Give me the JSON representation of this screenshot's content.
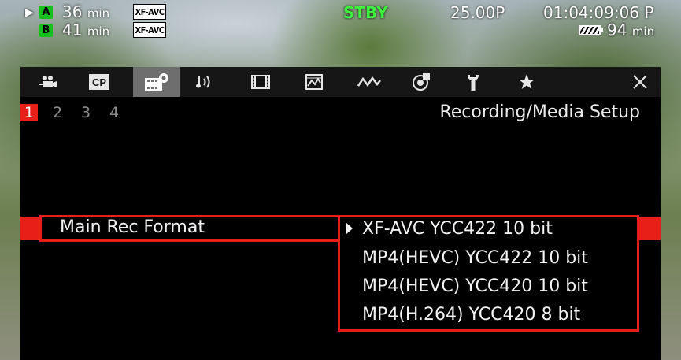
{
  "status": {
    "slot_a": {
      "tag": "A",
      "time": "36",
      "unit": "min",
      "codec": "XF-AVC"
    },
    "slot_b": {
      "tag": "B",
      "time": "41",
      "unit": "min",
      "codec": "XF-AVC"
    },
    "mode": "STBY",
    "frame_rate": "25.00P",
    "timecode": "01:04:09:06 P",
    "battery": {
      "value": "94",
      "unit": "min"
    }
  },
  "tabs": [
    {
      "icon": "camera-icon"
    },
    {
      "icon": "cp-icon",
      "label": "CP"
    },
    {
      "icon": "recording-setup-icon"
    },
    {
      "icon": "audio-icon"
    },
    {
      "icon": "film-icon"
    },
    {
      "icon": "display-assist-icon"
    },
    {
      "icon": "waveform-icon"
    },
    {
      "icon": "custom-function-icon"
    },
    {
      "icon": "wrench-icon"
    },
    {
      "icon": "star-icon"
    },
    {
      "icon": "close-icon"
    }
  ],
  "menu": {
    "pages": [
      "1",
      "2",
      "3",
      "4"
    ],
    "active_page": "1",
    "title": "Recording/Media Setup",
    "item_label": "Main Rec Format",
    "options": [
      "XF-AVC YCC422 10 bit",
      "MP4(HEVC) YCC422 10 bit",
      "MP4(HEVC) YCC420 10 bit",
      "MP4(H.264) YCC420 8 bit"
    ],
    "selected_option": "XF-AVC YCC422 10 bit"
  },
  "colors": {
    "accent": "#e81f18",
    "standby": "#3cf23c",
    "slot_tag": "#15c21d"
  }
}
